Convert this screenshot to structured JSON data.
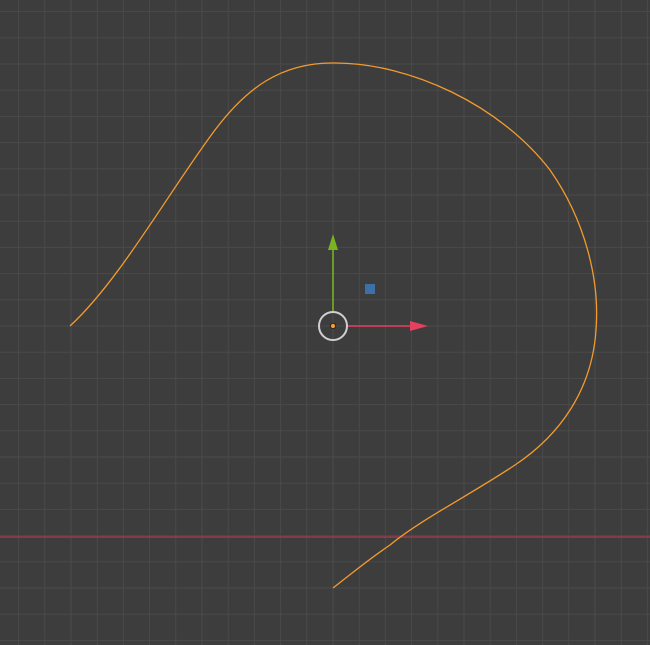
{
  "viewport": {
    "background": "#3d3d3d",
    "grid_color": "#4a4a4a",
    "x_axis_line_color": "#b0384f"
  },
  "curve": {
    "color": "#f39b2f",
    "selected": true
  },
  "gizmo": {
    "x_axis_color": "#e5405e",
    "y_axis_color": "#7ab322",
    "z_plane_handle_color": "#3d6fa8",
    "origin_dot_color": "#f39b2f",
    "pivot_ring_color": "#cfcfcf"
  }
}
